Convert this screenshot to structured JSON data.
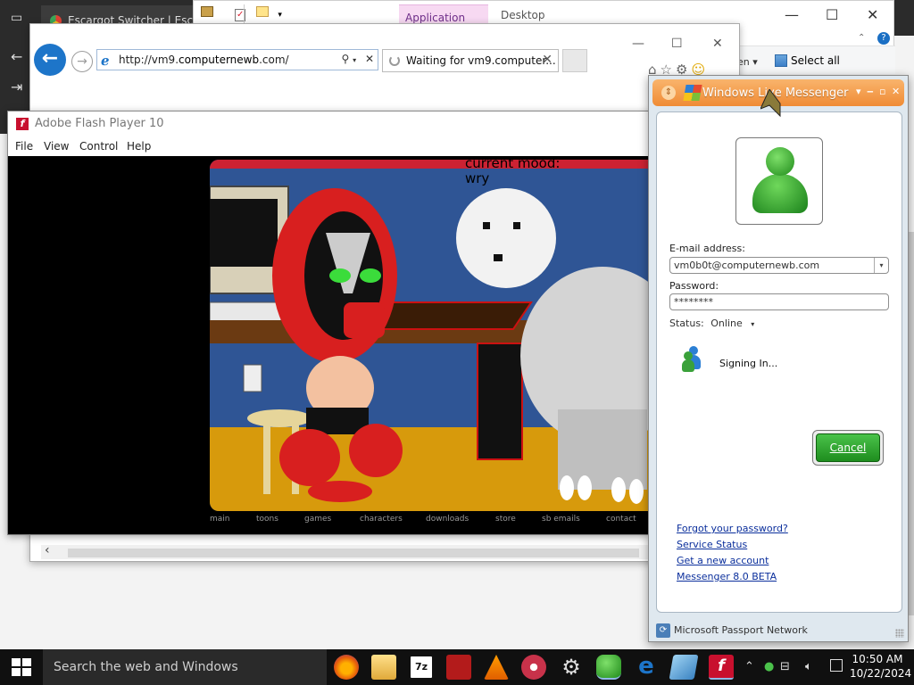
{
  "edge": {
    "tab_title": "Escargot Switcher | Escargot"
  },
  "explorer": {
    "tab_application_tools": "Application Tools",
    "tab_desktop": "Desktop",
    "open_label": "en",
    "select_all": "Select all",
    "help_glyph": "?"
  },
  "ie": {
    "url_prefix": "http://vm9.",
    "url_domain": "computernewb",
    "url_suffix": ".com/",
    "tab_title": "Waiting for vm9.computer...",
    "close_glyph": "✕"
  },
  "flash": {
    "title": "Adobe Flash Player 10",
    "menu": [
      "File",
      "View",
      "Control",
      "Help"
    ],
    "mood_line1": "current mood:",
    "mood_line2": "wry",
    "nav": [
      "main",
      "toons",
      "games",
      "characters",
      "downloads",
      "store",
      "sb emails",
      "contact"
    ]
  },
  "messenger": {
    "title": "Windows Live Messenger",
    "email_label": "E-mail address:",
    "email_value": "vm0b0t@computernewb.com",
    "password_label": "Password:",
    "password_value": "********",
    "status_label": "Status:",
    "status_value": "Online",
    "signing_in": "Signing In...",
    "cancel_button": "Cancel",
    "links": [
      "Forgot your password?",
      "Service Status",
      "Get a new account",
      "Messenger 8.0 BETA"
    ],
    "footer": "Microsoft Passport Network"
  },
  "taskbar": {
    "search_placeholder": "Search the web and Windows",
    "time": "10:50 AM",
    "date": "10/22/2024",
    "icons": [
      "firefox-icon",
      "file-explorer-icon",
      "7zip-icon",
      "media-icon",
      "vlc-icon",
      "settings-app-icon",
      "gear-icon",
      "messenger-icon",
      "ie-icon",
      "app-icon",
      "flash-icon"
    ]
  },
  "colors": {
    "ie_blue": "#1d75c9",
    "msn_orange": "#ef8b35",
    "msn_green": "#1e8d1e",
    "link_blue": "#0b2f9c"
  }
}
